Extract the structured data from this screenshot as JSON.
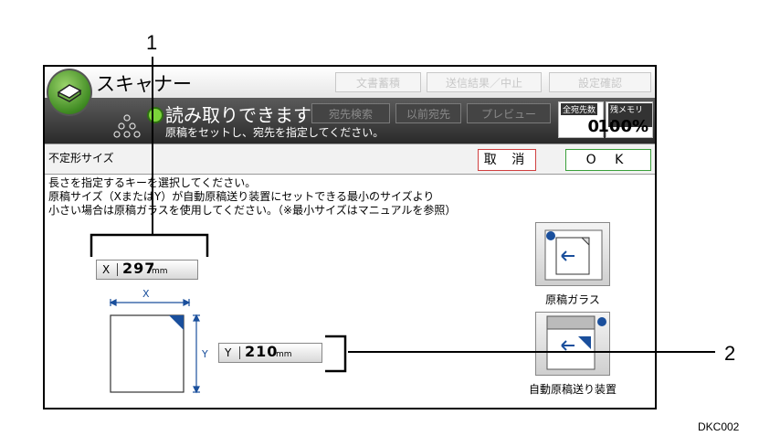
{
  "callouts": [
    "1",
    "2"
  ],
  "app": {
    "title": "スキャナー"
  },
  "top_buttons": [
    "文書蓄積",
    "送信結果／中止",
    "設定確認"
  ],
  "status": {
    "ready": "読み取りできます",
    "sub": "原稿をセットし、宛先を指定してください。",
    "buttons": [
      "宛先検索",
      "以前宛先",
      "プレビュー"
    ],
    "counters": [
      {
        "label": "全宛先数",
        "value": "0"
      },
      {
        "label": "残メモリー",
        "value": "100%"
      }
    ]
  },
  "section": {
    "title": "不定形サイズ",
    "cancel": "取 消",
    "ok": "O K"
  },
  "instructions": [
    "長さを指定するキーを選択してください。",
    "原稿サイズ（XまたはY）が自動原稿送り装置にセットできる最小のサイズより",
    "小さい場合は原稿ガラスを使用してください。（※最小サイズはマニュアルを参照）"
  ],
  "x_field": {
    "axis": "X",
    "value": "297",
    "unit": "mm"
  },
  "y_field": {
    "axis": "Y",
    "value": "210",
    "unit": "mm"
  },
  "diagram": {
    "x_label": "X",
    "y_label": "Y"
  },
  "originals": [
    {
      "label": "原稿ガラス",
      "icon": "platen-glass-icon"
    },
    {
      "label": "自動原稿送り装置",
      "icon": "adf-icon"
    }
  ],
  "figure_code": "DKC002",
  "colors": {
    "cancel_border": "#d04040",
    "ok_border": "#3aa03a",
    "accent_blue": "#1a4f9c"
  }
}
